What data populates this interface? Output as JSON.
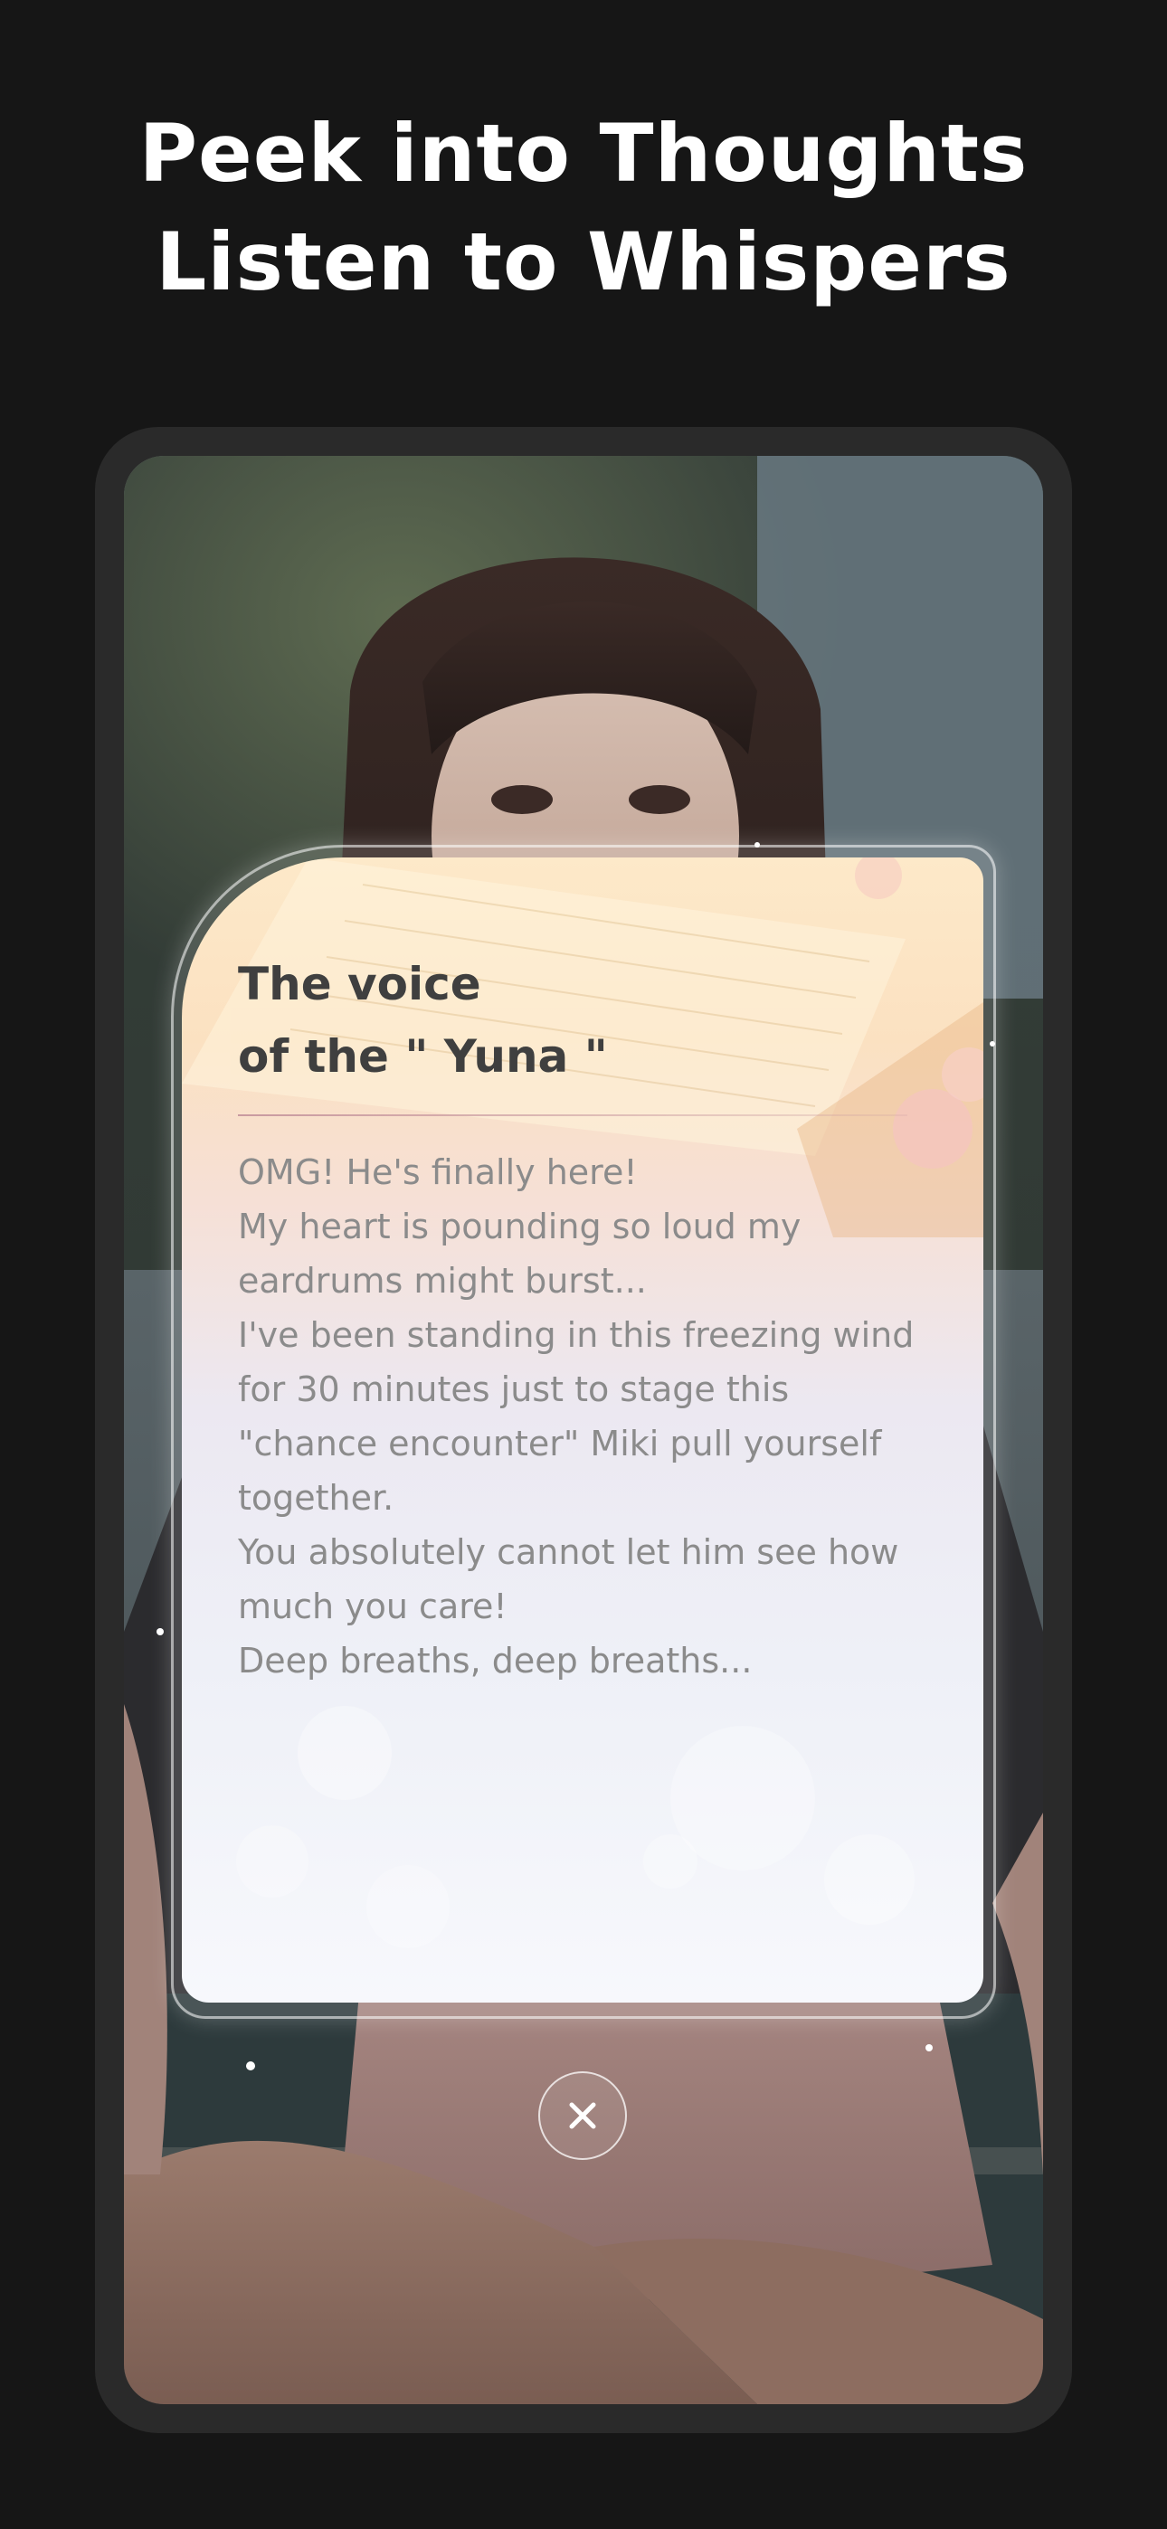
{
  "headline": {
    "line1": "Peek into Thoughts",
    "line2": "Listen to Whispers"
  },
  "card": {
    "title_line1": "The voice",
    "title_line2": "of the \" Yuna \"",
    "lines": [
      "OMG! He's finally here!",
      "My heart is pounding so loud my",
      "eardrums might burst...",
      "I've been standing in this freezing wind",
      "for 30 minutes just to stage this",
      "\"chance encounter\" Miki pull yourself",
      "together.",
      "You absolutely cannot let him see how",
      "much you care!",
      "Deep breaths, deep breaths..."
    ]
  },
  "close_button": {
    "icon": "close-icon"
  },
  "colors": {
    "page_background": "#161616",
    "phone_frame": "#2a2a2a",
    "headline_text": "#ffffff",
    "card_title": "#3f3f3f",
    "card_text": "#8b8b8b"
  }
}
